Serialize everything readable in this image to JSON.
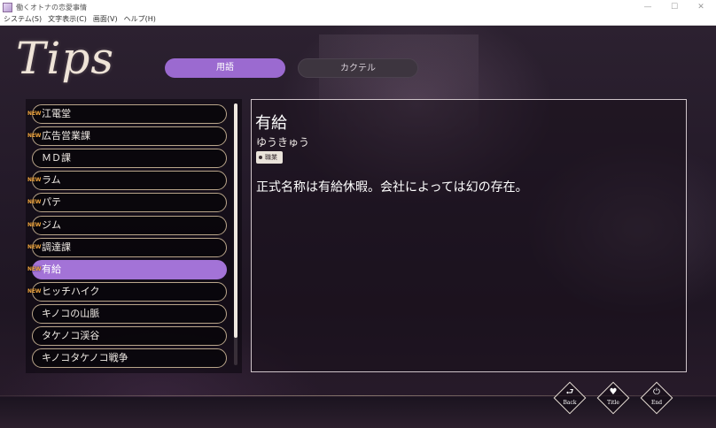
{
  "window": {
    "title": "働くオトナの恋愛事情",
    "minimize": "—",
    "maximize": "☐",
    "close": "✕"
  },
  "menu": [
    "システム(S)",
    "文字表示(C)",
    "画面(V)",
    "ヘルプ(H)"
  ],
  "logo": "Tips",
  "tabs": [
    {
      "label": "用語",
      "active": true
    },
    {
      "label": "カクテル",
      "active": false
    }
  ],
  "list": {
    "new_badge": "NEW",
    "items": [
      {
        "label": "江電堂",
        "is_new": true,
        "selected": false
      },
      {
        "label": "広告営業課",
        "is_new": true,
        "selected": false
      },
      {
        "label": "ＭＤ課",
        "is_new": false,
        "selected": false
      },
      {
        "label": "ラム",
        "is_new": true,
        "selected": false
      },
      {
        "label": "パテ",
        "is_new": true,
        "selected": false
      },
      {
        "label": "ジム",
        "is_new": true,
        "selected": false
      },
      {
        "label": "調達課",
        "is_new": true,
        "selected": false
      },
      {
        "label": "有給",
        "is_new": true,
        "selected": true
      },
      {
        "label": "ヒッチハイク",
        "is_new": true,
        "selected": false
      },
      {
        "label": "キノコの山脈",
        "is_new": false,
        "selected": false
      },
      {
        "label": "タケノコ渓谷",
        "is_new": false,
        "selected": false
      },
      {
        "label": "キノコタケノコ戦争",
        "is_new": false,
        "selected": false
      }
    ]
  },
  "detail": {
    "title": "有給",
    "reading": "ゆうきゅう",
    "tag": "職業",
    "body": "正式名称は有給休暇。会社によっては幻の存在。"
  },
  "buttons": [
    {
      "label": "Back",
      "icon": "back-icon",
      "glyph": "⮐"
    },
    {
      "label": "Title",
      "icon": "heart-icon",
      "glyph": "♥"
    },
    {
      "label": "End",
      "icon": "power-icon",
      "glyph": "⏻"
    }
  ],
  "colors": {
    "accent": "#a373d7",
    "tab_active": "#9b6ad0",
    "new_badge": "#f2a640",
    "row_border": "#b9a58a"
  }
}
